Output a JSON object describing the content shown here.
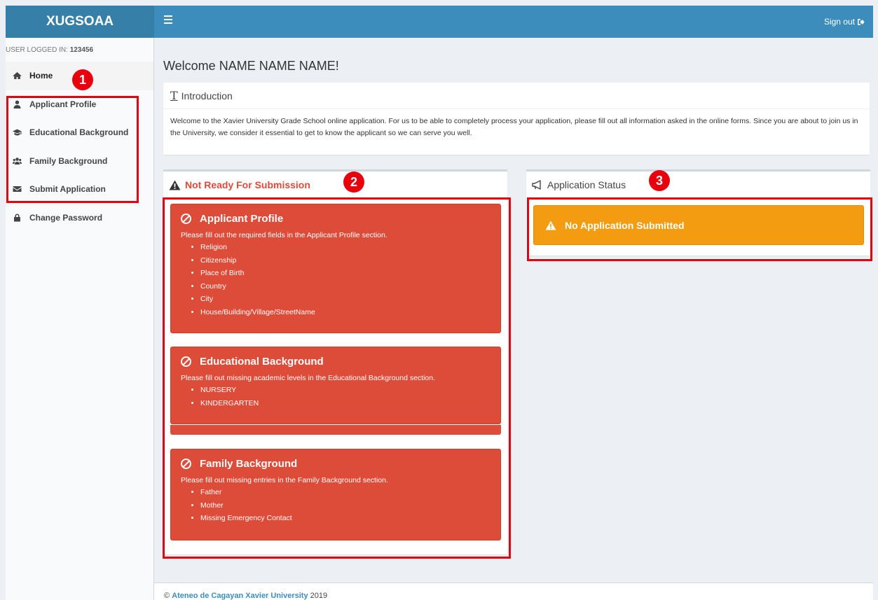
{
  "header": {
    "brand": "XUGSOAA",
    "signout_label": "Sign out"
  },
  "sidebar": {
    "user_label": "USER LOGGED IN:",
    "user_id": "123456",
    "items": [
      {
        "label": "Home",
        "icon": "home-icon"
      },
      {
        "label": "Applicant Profile",
        "icon": "user-icon"
      },
      {
        "label": "Educational Background",
        "icon": "graduation-cap-icon"
      },
      {
        "label": "Family Background",
        "icon": "users-icon"
      },
      {
        "label": "Submit Application",
        "icon": "envelope-icon"
      },
      {
        "label": "Change Password",
        "icon": "lock-icon"
      }
    ]
  },
  "main": {
    "welcome": "Welcome NAME NAME NAME!",
    "intro": {
      "title": "Introduction",
      "body": "Welcome to the Xavier University Grade School online application. For us to be able to completely process your application, please fill out all information asked in the online forms. Since you are about to join us in the University, we consider it essential to get to know the applicant so we can serve you well."
    },
    "not_ready": {
      "title": "Not Ready For Submission",
      "alerts": [
        {
          "title": "Applicant Profile",
          "message": "Please fill out the required fields in the Applicant Profile section.",
          "items": [
            "Religion",
            "Citizenship",
            "Place of Birth",
            "Country",
            "City",
            "House/Building/Village/StreetName"
          ]
        },
        {
          "title": "Educational Background",
          "message": "Please fill out missing academic levels in the Educational Background section.",
          "items": [
            "NURSERY",
            "KINDERGARTEN"
          ]
        },
        {
          "title": "Family Background",
          "message": "Please fill out missing entries in the Family Background section.",
          "items": [
            "Father",
            "Mother",
            "Missing Emergency Contact"
          ]
        }
      ]
    },
    "status": {
      "title": "Application Status",
      "message": "No Application Submitted"
    }
  },
  "footer": {
    "copyright": "©",
    "org": "Ateneo de Cagayan Xavier University",
    "year": "2019"
  },
  "annotations": [
    "1",
    "2",
    "3"
  ],
  "colors": {
    "header": "#3c8dbc",
    "brand": "#367fa9",
    "danger": "#dd4b39",
    "warning": "#f39c12",
    "annotation": "#e8000d"
  }
}
